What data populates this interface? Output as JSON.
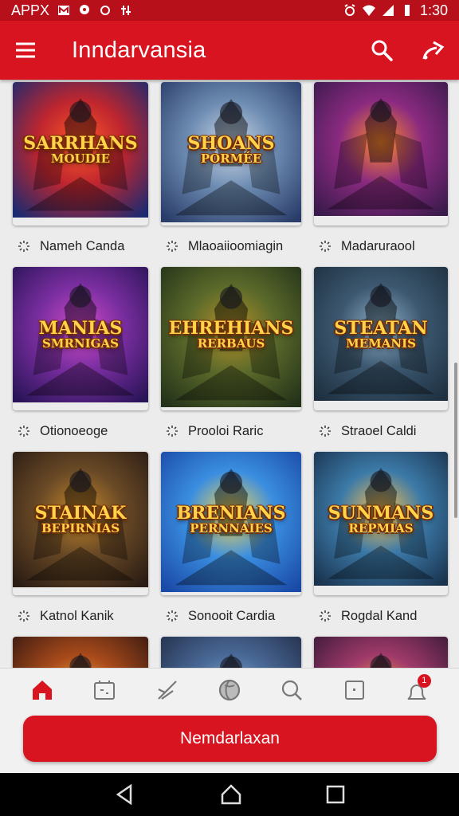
{
  "status_bar": {
    "carrier_label": "APPX",
    "time": "1:30"
  },
  "app_bar": {
    "title": "Inndarvansia",
    "icons": [
      "menu-icon",
      "search-icon",
      "share-icon"
    ]
  },
  "games": [
    {
      "title_art": "SARRHANS",
      "subtitle_art": "MOUDIE",
      "caption": "Nameh Canda",
      "palette": [
        "#1c2a70",
        "#c0262e",
        "#ff5a2a"
      ]
    },
    {
      "title_art": "SHOANS",
      "subtitle_art": "PORMÉE",
      "caption": "Mlaoaiioomiagin",
      "palette": [
        "#2a3d6a",
        "#6d8cb2",
        "#cfd9e6"
      ]
    },
    {
      "title_art": "",
      "subtitle_art": "",
      "caption": "Madaruraool",
      "palette": [
        "#3a1a4c",
        "#8a2a80",
        "#ff8a2a"
      ]
    },
    {
      "title_art": "MANIAS",
      "subtitle_art": "SMRNIGAS",
      "caption": "Otionoeoge",
      "palette": [
        "#2a1458",
        "#7a2ea0",
        "#d24cc8"
      ]
    },
    {
      "title_art": "EHREHIANS",
      "subtitle_art": "RERBAUS",
      "caption": "Prooloi Raric",
      "palette": [
        "#24321a",
        "#5b6a2a",
        "#b8902a"
      ]
    },
    {
      "title_art": "STEATAN",
      "subtitle_art": "MEMANIS",
      "caption": "Straoel Caldi",
      "palette": [
        "#1e3040",
        "#3c5870",
        "#8fb0c8"
      ]
    },
    {
      "title_art": "STAINAK",
      "subtitle_art": "BEPIRNIAS",
      "caption": "Katnol Kanik",
      "palette": [
        "#2b1c14",
        "#6a4a26",
        "#c8882a"
      ]
    },
    {
      "title_art": "BRENIANS",
      "subtitle_art": "PERNNAIES",
      "caption": "Sonooit Cardia",
      "palette": [
        "#1a4aa8",
        "#3a8ee0",
        "#ffd84a"
      ]
    },
    {
      "title_art": "SUNMANS",
      "subtitle_art": "REPMIAS",
      "caption": "Rogdal Kand",
      "palette": [
        "#1a3450",
        "#3c7aa8",
        "#ffc04a"
      ]
    },
    {
      "title_art": "",
      "subtitle_art": "",
      "caption": "",
      "palette": [
        "#3a1a12",
        "#a84a1a",
        "#ffb04a"
      ]
    },
    {
      "title_art": "",
      "subtitle_art": "",
      "caption": "",
      "palette": [
        "#24304c",
        "#4a6a98",
        "#9ab8d8"
      ]
    },
    {
      "title_art": "",
      "subtitle_art": "",
      "caption": "",
      "palette": [
        "#3c1a3a",
        "#a03a6a",
        "#ffa040"
      ]
    }
  ],
  "bottom_nav": {
    "items": [
      "home-icon",
      "widget-icon",
      "swords-icon",
      "globe-icon",
      "search-icon",
      "square-icon",
      "notifications-icon"
    ],
    "badge_count": "1",
    "active_color": "#d7141f"
  },
  "cta": {
    "label": "Nemdarlaxan"
  },
  "colors": {
    "accent": "#d7141f",
    "status_bar": "#b8101a"
  }
}
